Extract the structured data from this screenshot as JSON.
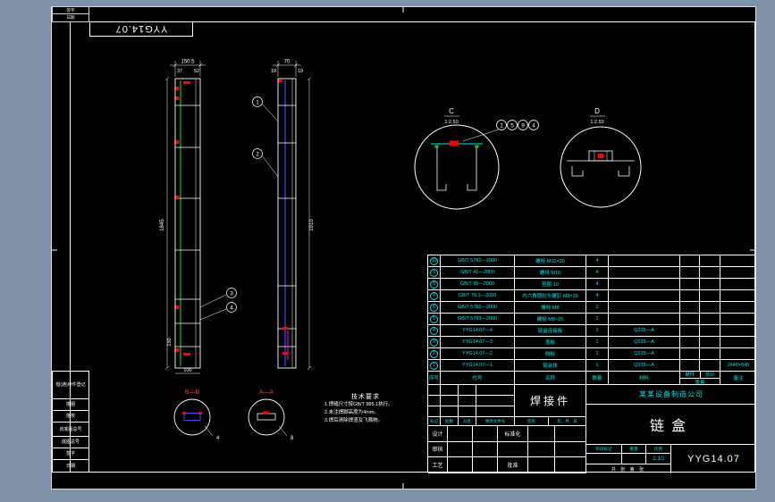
{
  "page": {
    "bg": "#7e93a8",
    "canvas": "#000000",
    "accent": "#00e5e5",
    "weld_red": "#ff0000",
    "line_green": "#00dd00",
    "line_blue": "#4747ff"
  },
  "corner_label": "YYG14.07",
  "margin_top_rows": [
    "签字",
    "日期"
  ],
  "margin_rows": [
    "借(通)用件登记",
    "描图",
    "描校",
    "旧底图总号",
    "底图总号",
    "签字",
    "日期"
  ],
  "views": {
    "left": {
      "dim_width": "150.5",
      "dim_w1": "37",
      "dim_w2": "52",
      "dim_height": "1845",
      "dim_side": "150",
      "dim_bottom": "100"
    },
    "right": {
      "dim_width": "70",
      "dim_w1": "19",
      "dim_w2": "19",
      "dim_height": "1910"
    },
    "balloons": [
      "1",
      "2",
      "3",
      "4"
    ]
  },
  "details": {
    "c": {
      "label": "C",
      "scale": "1:2.50",
      "balloons": [
        "1",
        "5",
        "9",
        "4"
      ]
    },
    "d": {
      "label": "D",
      "scale": "1:2.50"
    }
  },
  "sections": {
    "b": {
      "label": "B—B",
      "note": "4"
    },
    "a": {
      "label": "A—A",
      "note": "8"
    }
  },
  "notes": {
    "title": "技术要求",
    "lines": [
      "1.焊缝尺寸按GB/T 985.1执行。",
      "2.未注焊脚高度为4mm。",
      "3.焊后清除焊渣及飞溅物。"
    ]
  },
  "bom": {
    "headers": {
      "no": "序号",
      "code": "代号",
      "name": "名称",
      "qty": "数量",
      "material": "材料",
      "weight": "重量",
      "unit": "单件",
      "total": "总计",
      "remark": "备注"
    },
    "rows": [
      {
        "no": "10",
        "code": "GB/T 5782—2000",
        "name": "螺栓 M10×30",
        "qty": "4",
        "material": "",
        "remark": ""
      },
      {
        "no": "9",
        "code": "GB/T 41—2000",
        "name": "螺母 M10",
        "qty": "4",
        "material": "",
        "remark": ""
      },
      {
        "no": "8",
        "code": "GB/T 95—2000",
        "name": "垫圈 10",
        "qty": "4",
        "material": "",
        "remark": ""
      },
      {
        "no": "7",
        "code": "GB/T 70.1—2000",
        "name": "内六角圆柱头螺钉 M8×20",
        "qty": "4",
        "material": "",
        "remark": ""
      },
      {
        "no": "6",
        "code": "GB/T 5782—2000",
        "name": "螺栓 M8",
        "qty": "1",
        "material": "",
        "remark": ""
      },
      {
        "no": "5",
        "code": "GB/T 5783—2000",
        "name": "螺栓 M8×25",
        "qty": "1",
        "material": "",
        "remark": ""
      },
      {
        "no": "4",
        "code": "YYG14.07—4",
        "name": "链盒连接板",
        "qty": "1",
        "material": "Q235—A",
        "remark": ""
      },
      {
        "no": "3",
        "code": "YYG14.07—3",
        "name": "盖板",
        "qty": "1",
        "material": "Q235—A",
        "remark": ""
      },
      {
        "no": "2",
        "code": "YYG14.07—2",
        "name": "侧板",
        "qty": "1",
        "material": "Q235—A",
        "remark": ""
      },
      {
        "no": "1",
        "code": "YYG14.07—1",
        "name": "链盒体",
        "qty": "1",
        "material": "Q235—A",
        "remark": "2640×645"
      }
    ]
  },
  "title_block": {
    "stamp": "焊接件",
    "company": "某某设备制造公司",
    "part_name": "链盒",
    "drawing_no": "YYG14.07",
    "scale": "1:10",
    "rev_headers": [
      "标记",
      "处数",
      "分区",
      "更改文件号",
      "签名",
      "年、月、日"
    ],
    "signs": {
      "design": "设计",
      "audit": "审核",
      "craft": "工艺",
      "standard": "标准化",
      "approve": "批准"
    },
    "stage_label": "阶段标记",
    "weight_label": "重量",
    "scale_label": "比例",
    "sheet": "共 张 第 张"
  }
}
